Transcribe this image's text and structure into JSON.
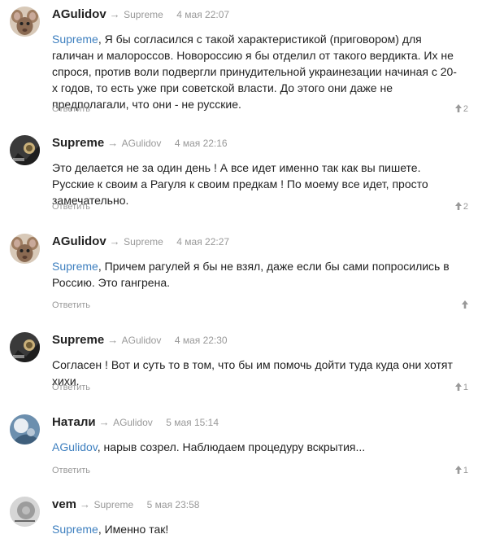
{
  "reply_label": "Ответить",
  "colors": {
    "link": "#3d7fbf",
    "muted": "#999999",
    "text": "#222222"
  },
  "comments": [
    {
      "author": "AGulidov",
      "reply_to": "Supreme",
      "date": "4 мая 22:07",
      "mention": "Supreme",
      "text": ", Я бы согласился с такой характеристикой (приговором) для галичан и малороссов. Новороссию я бы отделил от такого вердикта. Их не спрося, против воли подвергли принудительной украинезации начиная с 20-х годов, то есть уже при советской власти. До этого они даже не предполагали, что они - не русские.",
      "rating": "2",
      "avatar": "rat-icon"
    },
    {
      "author": "Supreme",
      "reply_to": "AGulidov",
      "date": "4 мая 22:16",
      "mention": "",
      "text": "Это делается не за один день ! А все идет именно так как вы пишете. Русские к своим а Рагуля к своим предкам ! По моему все идет, просто замечательно.",
      "rating": "2",
      "avatar": "supreme-avatar"
    },
    {
      "author": "AGulidov",
      "reply_to": "Supreme",
      "date": "4 мая 22:27",
      "mention": "Supreme",
      "text": ", Причем рагулей я бы не взял, даже если бы сами попросились в Россию. Это гангрена.",
      "rating": "",
      "avatar": "rat-icon"
    },
    {
      "author": "Supreme",
      "reply_to": "AGulidov",
      "date": "4 мая 22:30",
      "mention": "",
      "text": "Согласен ! Вот и суть то в том, что бы им помочь дойти туда куда они хотят хихи.",
      "rating": "1",
      "avatar": "supreme-avatar"
    },
    {
      "author": "Натали",
      "reply_to": "AGulidov",
      "date": "5 мая 15:14",
      "mention": "AGulidov",
      "text": ", нарыв созрел. Наблюдаем процедуру вскрытия...",
      "rating": "1",
      "avatar": "natali-avatar"
    },
    {
      "author": "vem",
      "reply_to": "Supreme",
      "date": "5 мая 23:58",
      "mention": "Supreme",
      "text": ", Именно так!",
      "rating": "",
      "avatar": "vem-avatar"
    }
  ]
}
